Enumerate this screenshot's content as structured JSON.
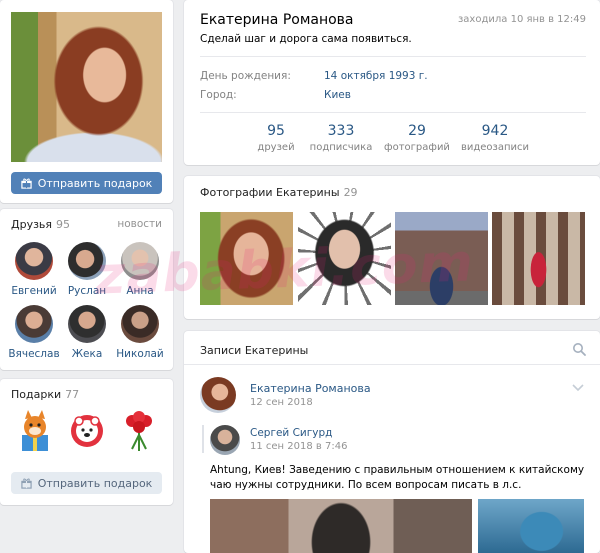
{
  "profile": {
    "name": "Екатерина Романова",
    "last_seen": "заходила 10 янв в 12:49",
    "status": "Сделай шаг и дорога сама появиться.",
    "info": [
      {
        "label": "День рождения:",
        "value": "14 октября 1993 г."
      },
      {
        "label": "Город:",
        "value": "Киев"
      }
    ],
    "counters": [
      {
        "num": "95",
        "label": "друзей"
      },
      {
        "num": "333",
        "label": "подписчика"
      },
      {
        "num": "29",
        "label": "фотографий"
      },
      {
        "num": "942",
        "label": "видеозаписи"
      }
    ]
  },
  "avatar": {
    "send_gift_label": "Отправить подарок"
  },
  "friends": {
    "title": "Друзья",
    "count": "95",
    "link": "новости",
    "items": [
      {
        "name": "Евгений"
      },
      {
        "name": "Руслан"
      },
      {
        "name": "Анна"
      },
      {
        "name": "Вячеслав"
      },
      {
        "name": "Жека"
      },
      {
        "name": "Николай"
      }
    ]
  },
  "gifts": {
    "title": "Подарки",
    "count": "77",
    "send_label": "Отправить подарок",
    "icons": [
      "fox-toy-icon",
      "polar-bear-toy-icon",
      "flowers-icon"
    ]
  },
  "photos": {
    "title": "Фотографии Екатерины",
    "count": "29"
  },
  "posts": {
    "title": "Записи Екатерины",
    "post": {
      "author": "Екатерина Романова",
      "date": "12 сен 2018",
      "repost_author": "Сергей Сигурд",
      "repost_date": "11 сен 2018 в 7:46",
      "text": "Ahtung, Киев! Заведению с правильным отношением к китайскому чаю нужны сотрудники. По всем вопросам писать в л.с."
    }
  },
  "watermark": "zababki.com",
  "colors": {
    "accent": "#5181b8",
    "link": "#2a5885",
    "background": "#edeef0"
  }
}
